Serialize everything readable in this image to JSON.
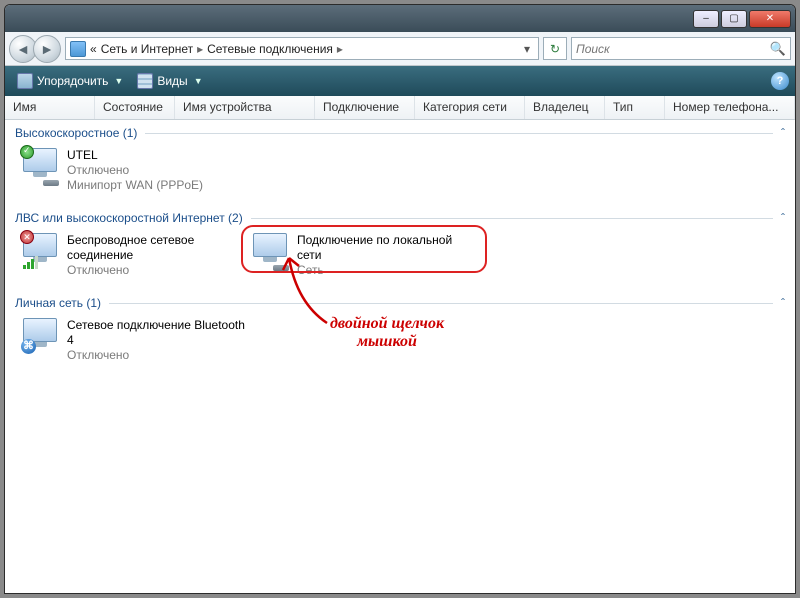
{
  "titlebar": {
    "min": "–",
    "max": "▢",
    "close": "✕"
  },
  "nav": {
    "back": "◄",
    "forward": "►",
    "refresh": "↻"
  },
  "breadcrumb": {
    "prefix": "«",
    "seg1": "Сеть и Интернет",
    "seg2": "Сетевые подключения",
    "sep": "▸",
    "dropdown": "▾"
  },
  "search": {
    "placeholder": "Поиск",
    "icon": "🔍"
  },
  "toolbar": {
    "organize": "Упорядочить",
    "views": "Виды",
    "help": "?"
  },
  "columns": {
    "name": "Имя",
    "state": "Состояние",
    "device": "Имя устройства",
    "conn": "Подключение",
    "cat": "Категория сети",
    "owner": "Владелец",
    "type": "Тип",
    "phone": "Номер телефона..."
  },
  "groups": [
    {
      "header": "Высокоскоростное (1)",
      "items": [
        {
          "title": "UTEL",
          "status": "Отключено",
          "desc": "Минипорт WAN (PPPoE)",
          "iconOverlay": "tick"
        }
      ]
    },
    {
      "header": "ЛВС или высокоскоростной Интернет (2)",
      "items": [
        {
          "title": "Беспроводное сетевое соединение",
          "status": "Отключено",
          "desc": "",
          "iconOverlay": "bars"
        },
        {
          "title": "Подключение по локальной сети",
          "status": "Сеть",
          "desc": "",
          "iconOverlay": "cable",
          "highlighted": true
        }
      ]
    },
    {
      "header": "Личная сеть (1)",
      "items": [
        {
          "title": "Сетевое подключение Bluetooth 4",
          "status": "Отключено",
          "desc": "",
          "iconOverlay": "bt"
        }
      ]
    }
  ],
  "collapse_glyph": "ˆ",
  "annotation": {
    "line1": "двойной щелчок",
    "line2": "мышкой"
  }
}
